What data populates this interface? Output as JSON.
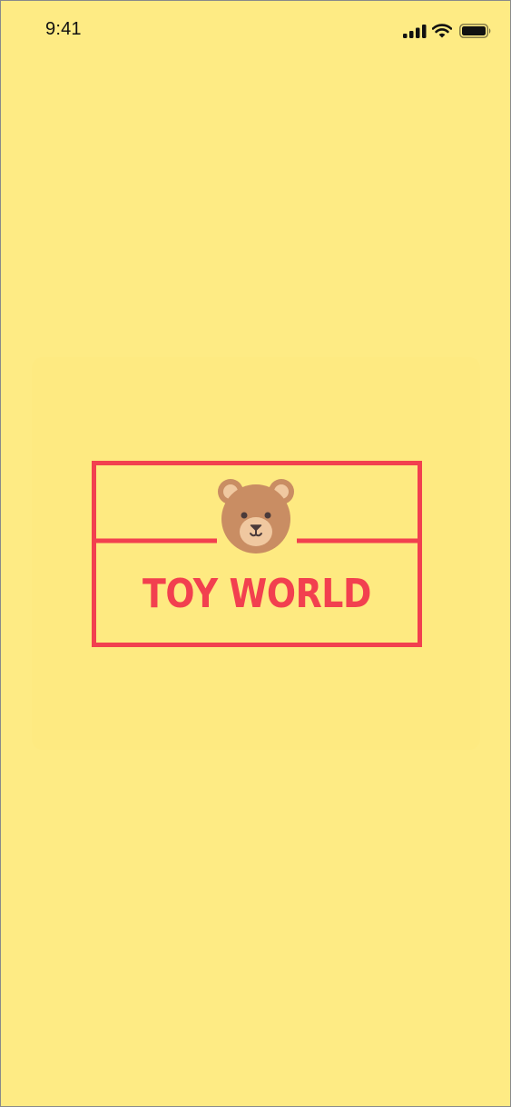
{
  "status_bar": {
    "time": "9:41",
    "icons": [
      "signal-icon",
      "wifi-icon",
      "battery-icon"
    ]
  },
  "splash": {
    "title": "TOY WORLD",
    "logo_icon": "teddy-bear-icon"
  },
  "colors": {
    "background": "#feeb84",
    "brand_red": "#f2404f",
    "bear_brown": "#c98d63",
    "bear_light": "#f0c8a0"
  }
}
